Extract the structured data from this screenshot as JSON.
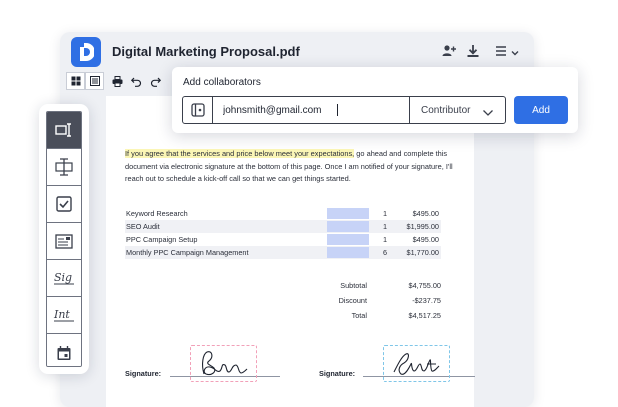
{
  "header": {
    "title": "Digital Marketing Proposal.pdf",
    "icons": [
      "add-user-icon",
      "download-icon",
      "menu-icon",
      "chevron-down-icon"
    ]
  },
  "toolbar": {
    "icons": [
      "grid-view-icon",
      "list-view-icon",
      "print-icon",
      "undo-icon",
      "redo-icon"
    ]
  },
  "palette": {
    "items": [
      "select-field-icon",
      "text-field-icon",
      "checkbox-icon",
      "dropdown-field-icon",
      "signature-icon",
      "initials-icon",
      "date-icon"
    ],
    "active_index": 0
  },
  "collaborators": {
    "title": "Add collaborators",
    "email_value": "johnsmith@gmail.com",
    "role": "Contributor",
    "add_label": "Add"
  },
  "document": {
    "intro_highlight": "If you agree that the services and price below meet your expectations,",
    "intro_rest": " go ahead and complete this document via electronic signature at the bottom of this page. Once I am notified of your signature, I'll reach out to schedule a kick-off call so that we can get things started.",
    "items": [
      {
        "name": "Keyword Research",
        "qty": "1",
        "price": "$495.00"
      },
      {
        "name": "SEO Audit",
        "qty": "1",
        "price": "$1,995.00"
      },
      {
        "name": "PPC Campaign Setup",
        "qty": "1",
        "price": "$495.00"
      },
      {
        "name": "Monthly PPC Campaign Management",
        "qty": "6",
        "price": "$1,770.00"
      }
    ],
    "totals": [
      {
        "label": "Subtotal",
        "value": "$4,755.00"
      },
      {
        "label": "Discount",
        "value": "-$237.75"
      },
      {
        "label": "Total",
        "value": "$4,517.25"
      }
    ],
    "signature_label_1": "Signature:",
    "signature_label_2": "Signature:",
    "colors": {
      "sig1_border": "#f2a0b8",
      "sig2_border": "#7fc6e8",
      "field": "#c7d3f7",
      "highlight": "#fbf6b6",
      "accent": "#2f6fe4"
    }
  }
}
